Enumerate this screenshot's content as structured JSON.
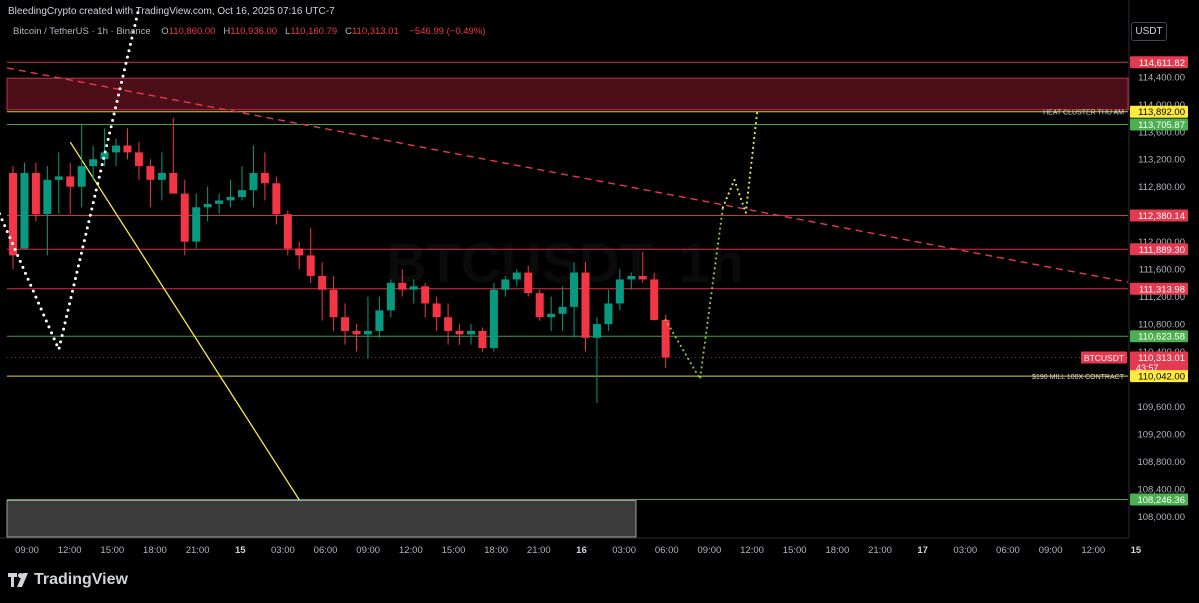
{
  "header": {
    "credit": "BleedingCrypto created with TradingView.com, Oct 16, 2025 07:16 UTC-7",
    "symbol": "Bitcoin / TetherUS · 1h · Binance",
    "open_label": "O",
    "open": "110,860.00",
    "high_label": "H",
    "high": "110,936.00",
    "low_label": "L",
    "low": "110,160.79",
    "close_label": "C",
    "close": "110,313.01",
    "change": "−546.99 (−0.49%)"
  },
  "price_unit": "USDT",
  "watermark": "BTCUSDT, 1h",
  "branding": "TradingView",
  "colors": {
    "up": "#089981",
    "down": "#f23645",
    "background": "#000000",
    "yellow": "#ffeb3b",
    "white_dots": "#ffffff",
    "green_line": "#4caf50",
    "red_line": "#e53950"
  },
  "chart_data": {
    "type": "candlestick",
    "symbol": "BTCUSDT",
    "interval": "1h",
    "ylim": [
      107700,
      115300
    ],
    "y_ticks": [
      "114,400.00",
      "114,000.00",
      "113,600.00",
      "113,200.00",
      "112,800.00",
      "112,000.00",
      "111,600.00",
      "111,200.00",
      "110,800.00",
      "110,400.00",
      "109,600.00",
      "109,200.00",
      "108,800.00",
      "108,400.00",
      "108,000.00"
    ],
    "x_ticks": [
      "09:00",
      "12:00",
      "15:00",
      "18:00",
      "21:00",
      "15",
      "03:00",
      "06:00",
      "09:00",
      "12:00",
      "15:00",
      "18:00",
      "21:00",
      "16",
      "03:00",
      "06:00",
      "09:00",
      "12:00",
      "15:00",
      "18:00",
      "21:00",
      "17",
      "03:00",
      "06:00",
      "09:00",
      "12:00",
      "15"
    ],
    "candles": [
      [
        113000,
        113100,
        111600,
        111800
      ],
      [
        111900,
        113150,
        111900,
        113000
      ],
      [
        113000,
        113150,
        112300,
        112400
      ],
      [
        112400,
        113100,
        111800,
        112900
      ],
      [
        112900,
        113300,
        112400,
        112950
      ],
      [
        112950,
        113150,
        112400,
        112800
      ],
      [
        112800,
        113700,
        112500,
        113100
      ],
      [
        113100,
        113400,
        112900,
        113200
      ],
      [
        113200,
        113650,
        113100,
        113300
      ],
      [
        113300,
        113500,
        113100,
        113400
      ],
      [
        113400,
        113650,
        113200,
        113300
      ],
      [
        113300,
        113450,
        112900,
        113100
      ],
      [
        113100,
        113200,
        112500,
        112900
      ],
      [
        112900,
        113300,
        112600,
        113000
      ],
      [
        113000,
        113800,
        112800,
        112700
      ],
      [
        112700,
        112900,
        111800,
        112000
      ],
      [
        112000,
        112700,
        111900,
        112500
      ],
      [
        112500,
        112800,
        112300,
        112550
      ],
      [
        112550,
        112700,
        112400,
        112600
      ],
      [
        112600,
        112900,
        112500,
        112650
      ],
      [
        112650,
        113100,
        112600,
        112750
      ],
      [
        112750,
        113400,
        112500,
        113000
      ],
      [
        113000,
        113300,
        112600,
        112850
      ],
      [
        112850,
        112950,
        112250,
        112400
      ],
      [
        112400,
        112450,
        111800,
        111900
      ],
      [
        111900,
        112000,
        111600,
        111800
      ],
      [
        111800,
        112200,
        111400,
        111500
      ],
      [
        111500,
        111700,
        110850,
        111300
      ],
      [
        111300,
        111500,
        110700,
        110900
      ],
      [
        110900,
        111100,
        110500,
        110700
      ],
      [
        110700,
        110800,
        110400,
        110650
      ],
      [
        110650,
        111200,
        110300,
        110700
      ],
      [
        110700,
        111200,
        110600,
        111000
      ],
      [
        111000,
        111450,
        110900,
        111400
      ],
      [
        111400,
        111600,
        111200,
        111300
      ],
      [
        111300,
        111450,
        111100,
        111350
      ],
      [
        111350,
        111400,
        110900,
        111100
      ],
      [
        111100,
        111200,
        110700,
        110900
      ],
      [
        110900,
        111100,
        110500,
        110700
      ],
      [
        110700,
        110800,
        110500,
        110650
      ],
      [
        110650,
        110800,
        110500,
        110700
      ],
      [
        110700,
        110750,
        110400,
        110450
      ],
      [
        110450,
        111400,
        110400,
        111300
      ],
      [
        111300,
        111500,
        111200,
        111450
      ],
      [
        111450,
        111600,
        111350,
        111550
      ],
      [
        111550,
        111650,
        111200,
        111250
      ],
      [
        111250,
        111300,
        110850,
        110900
      ],
      [
        110900,
        111200,
        110700,
        110950
      ],
      [
        110950,
        111350,
        110700,
        111050
      ],
      [
        111050,
        111700,
        110600,
        111550
      ],
      [
        111550,
        111700,
        110400,
        110600
      ],
      [
        110600,
        110900,
        109650,
        110800
      ],
      [
        110800,
        111300,
        110700,
        111100
      ],
      [
        111100,
        111600,
        111000,
        111450
      ],
      [
        111450,
        111550,
        111300,
        111500
      ],
      [
        111500,
        111850,
        111400,
        111450
      ],
      [
        111450,
        111550,
        110850,
        110860
      ],
      [
        110860,
        110936,
        110160,
        110313
      ]
    ],
    "levels": [
      {
        "price": 114611.82,
        "label": "114,611.82",
        "color": "#e53950"
      },
      {
        "price": 113892.0,
        "label": "113,892.00",
        "color": "#ffeb3b",
        "note": "HEAT CLUSTER THU AM"
      },
      {
        "price": 113705.87,
        "label": "113,705.87",
        "color": "#4caf50"
      },
      {
        "price": 112380.14,
        "label": "112,380.14",
        "color": "#e53950"
      },
      {
        "price": 111889.3,
        "label": "111,889.30",
        "color": "#e53950"
      },
      {
        "price": 111313.98,
        "label": "111,313.98",
        "color": "#e53950"
      },
      {
        "price": 110623.58,
        "label": "110,623.58",
        "color": "#4caf50"
      },
      {
        "price": 110313.01,
        "label": "110,313.01",
        "color": "#e53950",
        "tag": "BTCUSDT",
        "countdown": "43:57"
      },
      {
        "price": 110042.0,
        "label": "110,042.00",
        "color": "#ffeb3b",
        "note": "$190 MILL 100X CONTRACT"
      },
      {
        "price": 108246.36,
        "label": "108,246.36",
        "color": "#4caf50"
      }
    ],
    "zone": {
      "from": 113920,
      "to": 114380,
      "color": "#8b1a2b"
    },
    "dotted_projection": [
      [
        57,
        110860
      ],
      [
        60,
        110000
      ],
      [
        62,
        112500
      ],
      [
        63,
        112900
      ],
      [
        64,
        112420
      ],
      [
        65,
        113900
      ]
    ],
    "white_dotted_path": [
      [
        -3,
        113100
      ],
      [
        4,
        110430
      ],
      [
        11,
        115400
      ]
    ]
  }
}
